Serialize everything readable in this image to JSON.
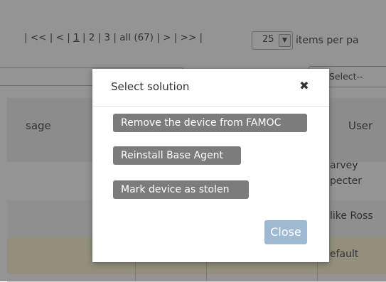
{
  "pager": {
    "first": "<<",
    "prev": "<",
    "pages": [
      "1",
      "2",
      "3"
    ],
    "all": "all (67)",
    "next": ">",
    "last": ">>",
    "per_page_value": "25",
    "per_page_label": "items per pa"
  },
  "filters": {
    "select_value": "Select--"
  },
  "table": {
    "headers": {
      "message": "sage",
      "user": "User"
    },
    "rows": [
      {
        "user": "arvey pecter"
      },
      {
        "user": "like Ross"
      },
      {
        "user": "efault"
      }
    ]
  },
  "modal": {
    "title": "Select solution",
    "close_icon": "✖",
    "options": [
      "Remove the device from FAMOC",
      "Reinstall Base Agent",
      "Mark device as stolen"
    ],
    "close_label": "Close"
  },
  "colors": {
    "option_button": "#7c7c7c",
    "close_button": "#9fbad0",
    "highlight_row": "#fff7d6"
  }
}
